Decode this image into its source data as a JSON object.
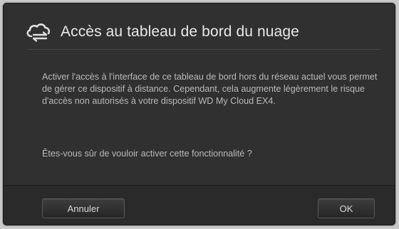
{
  "dialog": {
    "title": "Accès au tableau de bord du nuage",
    "title_icon": "cloud-sync-icon",
    "message": "Activer l'accès à l'interface de ce tableau de bord hors du réseau actuel vous permet de gérer ce dispositif à distance. Cependant, cela augmente légèrement le risque d'accès non autorisés à votre dispositif WD My Cloud EX4.",
    "question": "Êtes-vous sûr de vouloir activer cette fonctionnalité ?",
    "cancel_label": "Annuler",
    "ok_label": "OK"
  },
  "colors": {
    "dialog_background": "#303030",
    "text": "#b9b9b9",
    "title_text": "#e8e8e8"
  }
}
